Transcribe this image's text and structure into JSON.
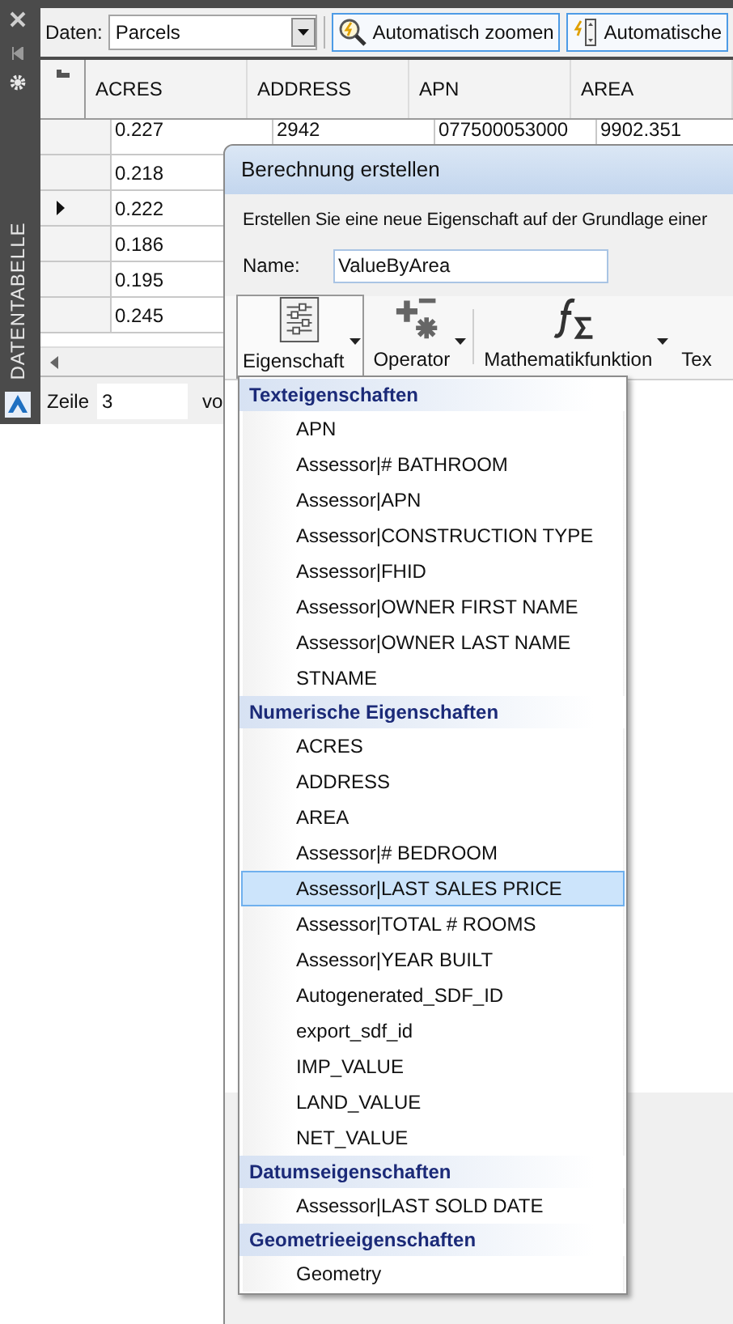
{
  "palette": {
    "title": "DATENTABELLE"
  },
  "toolbar": {
    "data_label": "Daten:",
    "data_value": "Parcels",
    "buttons": [
      {
        "label": "Automatisch zoomen",
        "kind": "zoom"
      },
      {
        "label": "Automatische",
        "kind": "select"
      }
    ]
  },
  "table": {
    "columns": [
      "ACRES",
      "ADDRESS",
      "APN",
      "AREA"
    ],
    "rows": [
      {
        "cells": [
          "0.227",
          "2942",
          "077500053000",
          "9902.351"
        ],
        "current": false
      },
      {
        "cells": [
          "0.218"
        ],
        "current": false
      },
      {
        "cells": [
          "0.222"
        ],
        "current": true
      },
      {
        "cells": [
          "0.186"
        ],
        "current": false
      },
      {
        "cells": [
          "0.195"
        ],
        "current": false
      },
      {
        "cells": [
          "0.245"
        ],
        "current": false
      }
    ]
  },
  "footer": {
    "label": "Zeile",
    "value": "3",
    "suffix": "vo"
  },
  "dialog": {
    "title": "Berechnung erstellen",
    "description": "Erstellen Sie eine neue Eigenschaft auf der Grundlage einer",
    "name_label": "Name:",
    "name_value": "ValueByArea",
    "tools": [
      {
        "label": "Eigenschaft",
        "kind": "property",
        "pressed": true,
        "dropdown": true
      },
      {
        "label": "Operator",
        "kind": "operator",
        "pressed": false,
        "dropdown": true
      },
      {
        "label": "Mathematikfunktion",
        "kind": "function",
        "pressed": false,
        "dropdown": true
      },
      {
        "label": "Tex",
        "kind": "text",
        "pressed": false,
        "dropdown": false
      }
    ]
  },
  "menu": {
    "groups": [
      {
        "title": "Texteigenschaften",
        "items": [
          {
            "label": "APN",
            "selected": false
          },
          {
            "label": "Assessor|# BATHROOM",
            "selected": false
          },
          {
            "label": "Assessor|APN",
            "selected": false
          },
          {
            "label": "Assessor|CONSTRUCTION TYPE",
            "selected": false
          },
          {
            "label": "Assessor|FHID",
            "selected": false
          },
          {
            "label": "Assessor|OWNER FIRST NAME",
            "selected": false
          },
          {
            "label": "Assessor|OWNER LAST NAME",
            "selected": false
          },
          {
            "label": "STNAME",
            "selected": false
          }
        ]
      },
      {
        "title": "Numerische Eigenschaften",
        "items": [
          {
            "label": "ACRES",
            "selected": false
          },
          {
            "label": "ADDRESS",
            "selected": false
          },
          {
            "label": "AREA",
            "selected": false
          },
          {
            "label": "Assessor|# BEDROOM",
            "selected": false
          },
          {
            "label": "Assessor|LAST SALES PRICE",
            "selected": true
          },
          {
            "label": "Assessor|TOTAL # ROOMS",
            "selected": false
          },
          {
            "label": "Assessor|YEAR BUILT",
            "selected": false
          },
          {
            "label": "Autogenerated_SDF_ID",
            "selected": false
          },
          {
            "label": "export_sdf_id",
            "selected": false
          },
          {
            "label": "IMP_VALUE",
            "selected": false
          },
          {
            "label": "LAND_VALUE",
            "selected": false
          },
          {
            "label": "NET_VALUE",
            "selected": false
          }
        ]
      },
      {
        "title": "Datumseigenschaften",
        "items": [
          {
            "label": "Assessor|LAST SOLD DATE",
            "selected": false
          }
        ]
      },
      {
        "title": "Geometrieeigenschaften",
        "items": [
          {
            "label": "Geometry",
            "selected": false
          }
        ]
      }
    ]
  }
}
